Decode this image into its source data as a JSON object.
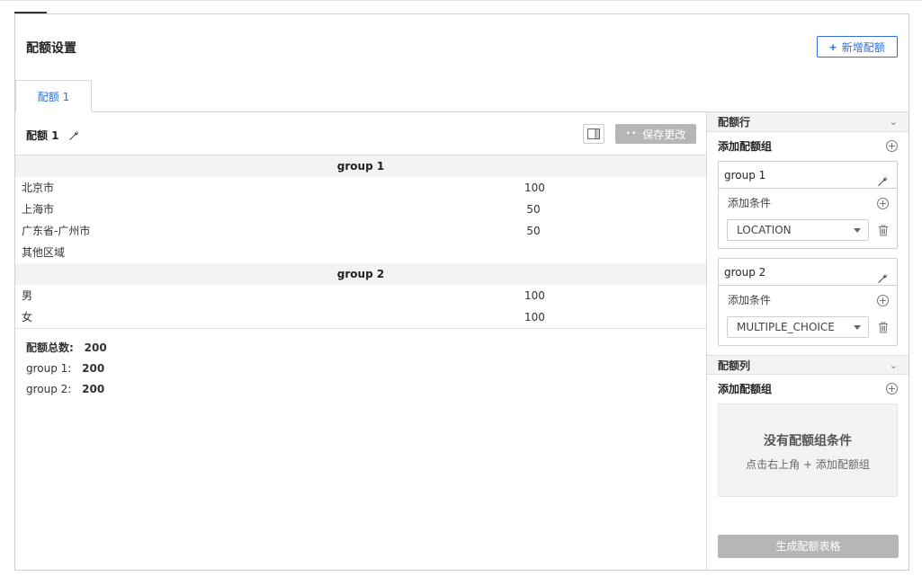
{
  "header": {
    "title": "配额设置",
    "add_button_label": "新增配额"
  },
  "tabs": [
    {
      "label": "配额 1"
    }
  ],
  "quota": {
    "name": "配额 1",
    "save_label": "保存更改"
  },
  "table": {
    "groups": [
      {
        "name": "group 1",
        "rows": [
          {
            "name": "北京市",
            "value": "100"
          },
          {
            "name": "上海市",
            "value": "50"
          },
          {
            "name": "广东省-广州市",
            "value": "50"
          },
          {
            "name": "其他区域",
            "value": ""
          }
        ]
      },
      {
        "name": "group 2",
        "rows": [
          {
            "name": "男",
            "value": "100"
          },
          {
            "name": "女",
            "value": "100"
          }
        ]
      }
    ]
  },
  "totals": {
    "total_label": "配额总数:",
    "total_value": "200",
    "group1_label": "group 1:",
    "group1_value": "200",
    "group2_label": "group 2:",
    "group2_value": "200"
  },
  "panel": {
    "rows_section": {
      "title": "配额行",
      "add_group_label": "添加配额组",
      "groups": [
        {
          "name": "group 1",
          "add_condition_label": "添加条件",
          "select_value": "LOCATION"
        },
        {
          "name": "group 2",
          "add_condition_label": "添加条件",
          "select_value": "MULTIPLE_CHOICE"
        }
      ]
    },
    "cols_section": {
      "title": "配额列",
      "add_group_label": "添加配额组",
      "empty_title": "没有配额组条件",
      "empty_hint": "点击右上角 + 添加配额组"
    },
    "generate_label": "生成配额表格"
  },
  "colors": {
    "accent": "#2f6fd6",
    "disabled_button": "#b6b6b6",
    "header_bg": "#f3f3f3"
  }
}
